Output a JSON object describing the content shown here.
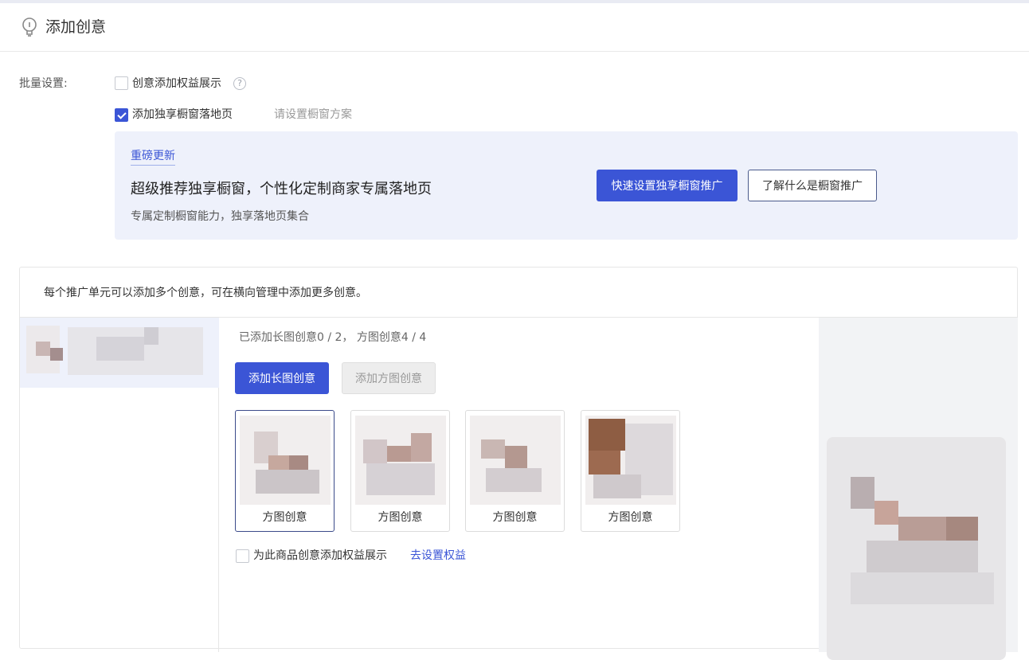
{
  "header": {
    "title": "添加创意"
  },
  "batch": {
    "label": "批量设置:",
    "option1": {
      "label": "创意添加权益展示",
      "checked": false
    },
    "option2": {
      "label": "添加独享橱窗落地页",
      "checked": true,
      "hint": "请设置橱窗方案"
    }
  },
  "promo": {
    "tag": "重磅更新",
    "headline": "超级推荐独享橱窗，个性化定制商家专属落地页",
    "sub": "专属定制橱窗能力，独享落地页集合",
    "primary_button": "快速设置独享橱窗推广",
    "secondary_button": "了解什么是橱窗推广"
  },
  "panel": {
    "note": "每个推广单元可以添加多个创意，可在横向管理中添加更多创意。",
    "count_text": "已添加长图创意0 / 2， 方图创意4 / 4",
    "add_long_button": "添加长图创意",
    "add_square_button": "添加方图创意",
    "cards": [
      {
        "label": "方图创意",
        "active": true
      },
      {
        "label": "方图创意",
        "active": false
      },
      {
        "label": "方图创意",
        "active": false
      },
      {
        "label": "方图创意",
        "active": false
      }
    ],
    "rights_checkbox": {
      "label": "为此商品创意添加权益展示",
      "checked": false
    },
    "rights_link": "去设置权益"
  },
  "colors": {
    "accent": "#3b55d6",
    "promo_bg": "#eef1fb"
  }
}
